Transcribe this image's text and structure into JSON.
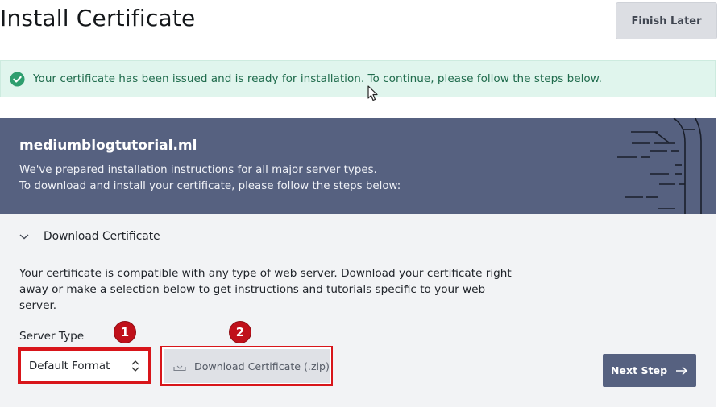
{
  "header": {
    "title": "Install Certificate",
    "finish_later_label": "Finish Later"
  },
  "alert": {
    "icon": "check-circle-icon",
    "message": "Your certificate has been issued and is ready for installation. To continue, please follow the steps below.",
    "color": "#1f6b4c"
  },
  "hero": {
    "domain": "mediumblogtutorial.ml",
    "line1": "We've prepared installation instructions for all major server types.",
    "line2": "To download and install your certificate, please follow the steps below:",
    "background": "#566180"
  },
  "download_section": {
    "title": "Download Certificate",
    "description": "Your certificate is compatible with any type of web server. Download your certificate right away or make a selection below to get instructions and tutorials specific to your web server.",
    "server_type_label": "Server Type",
    "server_type_value": "Default Format",
    "download_button_label": "Download Certificate (.zip)",
    "next_step_label": "Next Step"
  },
  "annotations": {
    "badge1": "1",
    "badge2": "2",
    "highlight_color": "#d8151a"
  }
}
